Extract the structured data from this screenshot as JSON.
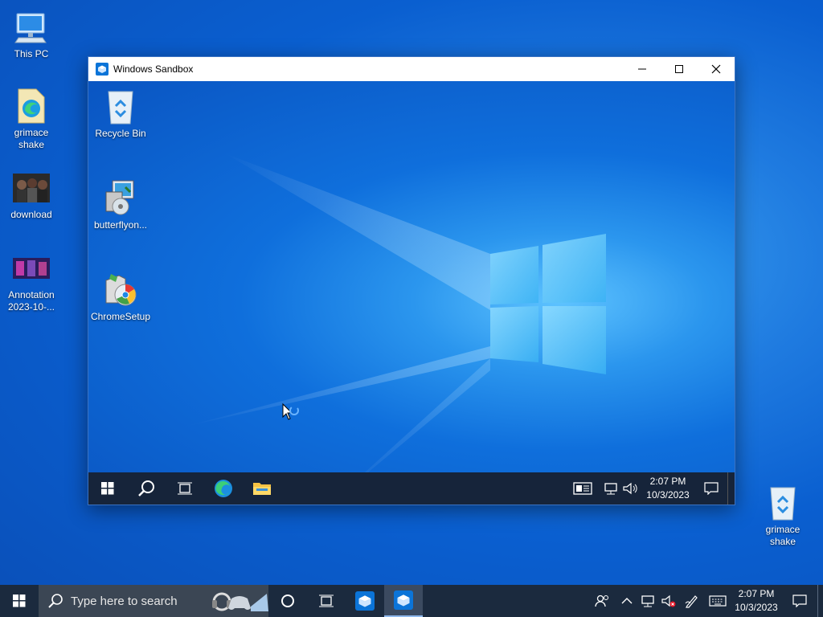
{
  "desktop": {
    "icons": [
      {
        "label": "This PC"
      },
      {
        "label": "grimace shake"
      },
      {
        "label": "download"
      },
      {
        "label": "Annotation 2023-10-..."
      },
      {
        "label": "grimace shake"
      }
    ]
  },
  "sandbox": {
    "title": "Windows Sandbox",
    "icons": [
      {
        "label": "Recycle Bin"
      },
      {
        "label": "butterflyon..."
      },
      {
        "label": "ChromeSetup"
      }
    ],
    "taskbar": {
      "time": "2:07 PM",
      "date": "10/3/2023"
    }
  },
  "taskbar": {
    "search_placeholder": "Type here to search",
    "time": "2:07 PM",
    "date": "10/3/2023"
  },
  "colors": {
    "accent": "#0a5fd0",
    "taskbar": "#1b2a3e",
    "inner_taskbar": "#16243a"
  }
}
